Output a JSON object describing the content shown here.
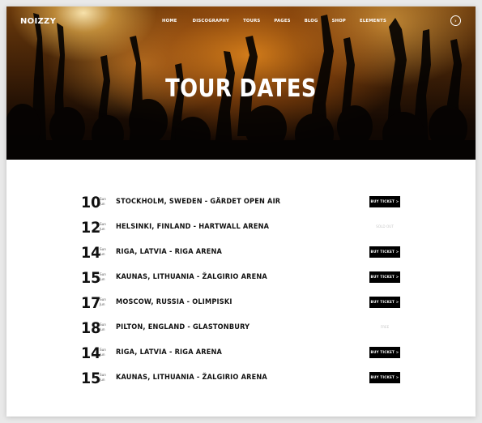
{
  "header": {
    "logo": "NOIZZY",
    "nav": [
      "HOME",
      "DISCOGRAPHY",
      "TOURS",
      "PAGES",
      "BLOG",
      "SHOP",
      "ELEMENTS"
    ],
    "menu_icon": "›"
  },
  "hero": {
    "title": "TOUR DATES"
  },
  "tours": [
    {
      "day": "10",
      "month": "Sun",
      "year": "Jun",
      "venue": "STOCKHOLM, SWEDEN - GÄRDET OPEN AIR",
      "action": "BUY TICKET >",
      "status": ""
    },
    {
      "day": "12",
      "month": "Sun",
      "year": "Jun",
      "venue": "HELSINKI, FINLAND - HARTWALL ARENA",
      "action": "",
      "status": "SOLD OUT"
    },
    {
      "day": "14",
      "month": "Sun",
      "year": "Jun",
      "venue": "RIGA, LATVIA - RIGA ARENA",
      "action": "BUY TICKET >",
      "status": ""
    },
    {
      "day": "15",
      "month": "Sun",
      "year": "Jun",
      "venue": "KAUNAS, LITHUANIA - ŽALGIRIO ARENA",
      "action": "BUY TICKET >",
      "status": ""
    },
    {
      "day": "17",
      "month": "Sun",
      "year": "Jun",
      "venue": "MOSCOW, RUSSIA - OLIMPISKI",
      "action": "BUY TICKET >",
      "status": ""
    },
    {
      "day": "18",
      "month": "Sun",
      "year": "Jun",
      "venue": "PILTON, ENGLAND - GLASTONBURY",
      "action": "",
      "status": "FREE"
    },
    {
      "day": "14",
      "month": "Sun",
      "year": "Jun",
      "venue": "RIGA, LATVIA - RIGA ARENA",
      "action": "BUY TICKET >",
      "status": ""
    },
    {
      "day": "15",
      "month": "Sun",
      "year": "Jun",
      "venue": "KAUNAS, LITHUANIA - ŽALGIRIO ARENA",
      "action": "BUY TICKET >",
      "status": ""
    }
  ],
  "colors": {
    "button_bg": "#000000",
    "button_text": "#ffffff",
    "muted_status": "#c9c9c9",
    "hero_orange": "#e08a2a"
  }
}
